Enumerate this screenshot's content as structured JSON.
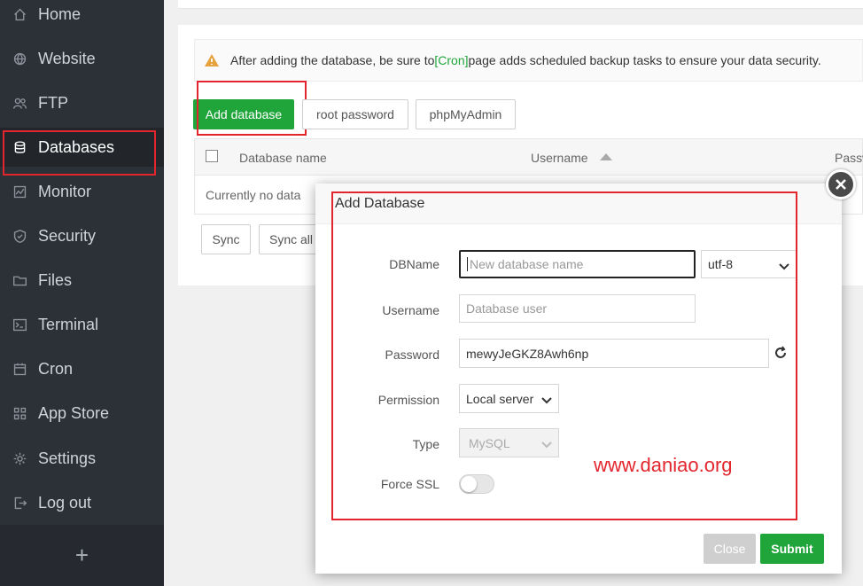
{
  "sidebar": {
    "items": [
      {
        "label": "Home",
        "icon": "home-icon"
      },
      {
        "label": "Website",
        "icon": "globe-icon"
      },
      {
        "label": "FTP",
        "icon": "users-icon"
      },
      {
        "label": "Databases",
        "icon": "database-icon",
        "active": true
      },
      {
        "label": "Monitor",
        "icon": "monitor-icon"
      },
      {
        "label": "Security",
        "icon": "shield-icon"
      },
      {
        "label": "Files",
        "icon": "folder-icon"
      },
      {
        "label": "Terminal",
        "icon": "terminal-icon"
      },
      {
        "label": "Cron",
        "icon": "calendar-icon"
      },
      {
        "label": "App Store",
        "icon": "grid-icon"
      },
      {
        "label": "Settings",
        "icon": "gear-icon"
      },
      {
        "label": "Log out",
        "icon": "logout-icon"
      }
    ],
    "add_label": "+"
  },
  "notice": {
    "before": "After adding the database, be sure to ",
    "link": "[Cron]",
    "after": " page adds scheduled backup tasks to ensure your data security."
  },
  "toolbar": {
    "add_database": "Add database",
    "root_password": "root password",
    "phpmyadmin": "phpMyAdmin"
  },
  "table": {
    "columns": [
      "Database name",
      "Username",
      "Passw"
    ],
    "empty_text": "Currently no data"
  },
  "footer_buttons": {
    "sync": "Sync",
    "sync_all": "Sync all"
  },
  "modal": {
    "title": "Add Database",
    "dbname_label": "DBName",
    "dbname_placeholder": "New database name",
    "charset_value": "utf-8",
    "username_label": "Username",
    "username_placeholder": "Database user",
    "password_label": "Password",
    "password_value": "mewyJeGKZ8Awh6np",
    "permission_label": "Permission",
    "permission_value": "Local server",
    "type_label": "Type",
    "type_value": "MySQL",
    "force_ssl_label": "Force SSL",
    "force_ssl_on": false,
    "close_label": "Close",
    "submit_label": "Submit"
  },
  "watermark": "www.daniao.org",
  "colors": {
    "accent_green": "#20a53a",
    "sidebar_bg": "#2c3138",
    "highlight_red": "#e3262e"
  }
}
